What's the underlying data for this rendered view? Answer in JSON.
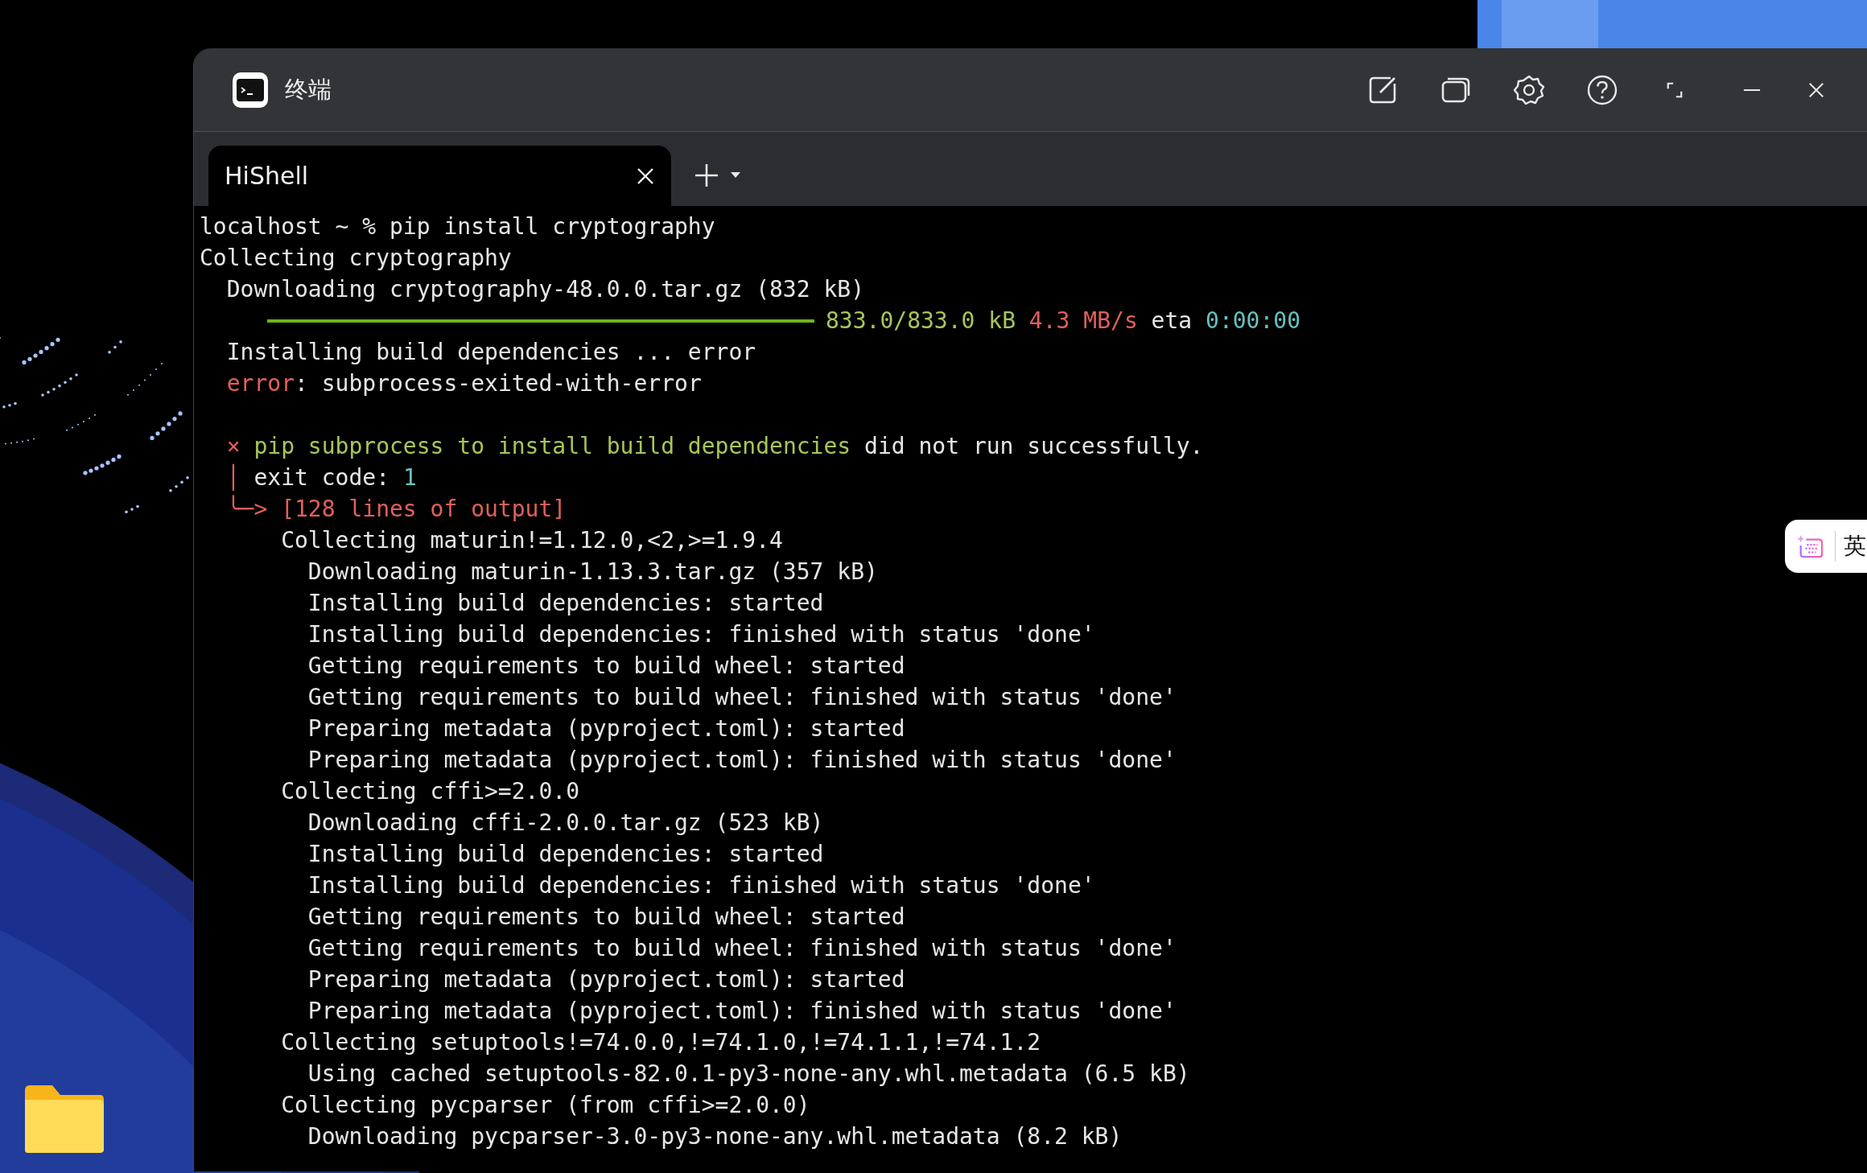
{
  "window": {
    "title": "终端"
  },
  "tabs": [
    {
      "label": "HiShell",
      "selected": true
    }
  ],
  "terminal": {
    "lines": [
      {
        "kind": "text",
        "segments": [
          {
            "text": "localhost ~ % pip install cryptography",
            "color": "#e6e6e6"
          }
        ]
      },
      {
        "kind": "text",
        "segments": [
          {
            "text": "Collecting cryptography",
            "color": "#e6e6e6"
          }
        ]
      },
      {
        "kind": "text",
        "segments": [
          {
            "text": "  Downloading cryptography-48.0.0.tar.gz (832 kB)",
            "color": "#e6e6e6"
          }
        ]
      },
      {
        "kind": "progress",
        "level": 1,
        "segments": [
          {
            "text": "833.0/833.0 kB",
            "color": "#a7c65a"
          },
          {
            "text": " 4.3 MB/s",
            "color": "#e0605a"
          },
          {
            "text": " eta ",
            "color": "#e6e6e6"
          },
          {
            "text": "0:00:00",
            "color": "#66c2c0"
          }
        ]
      },
      {
        "kind": "text",
        "segments": [
          {
            "text": "  Installing build dependencies ... error",
            "color": "#e6e6e6"
          }
        ]
      },
      {
        "kind": "text",
        "segments": [
          {
            "text": "  error",
            "color": "#e0605a"
          },
          {
            "text": ": subprocess-exited-with-error",
            "color": "#e6e6e6"
          }
        ]
      },
      {
        "kind": "blank"
      },
      {
        "kind": "text",
        "segments": [
          {
            "text": "  ×",
            "color": "#e0605a"
          },
          {
            "text": " pip subprocess to install build dependencies",
            "color": "#a7c65a"
          },
          {
            "text": " did not run successfully.",
            "color": "#e6e6e6"
          }
        ]
      },
      {
        "kind": "text",
        "segments": [
          {
            "text": "  │",
            "color": "#e0605a"
          },
          {
            "text": " exit code: ",
            "color": "#e6e6e6"
          },
          {
            "text": "1",
            "color": "#66c2c0"
          }
        ]
      },
      {
        "kind": "text",
        "segments": [
          {
            "text": "  ╰─> [128 lines of output]",
            "color": "#e0605a"
          }
        ]
      },
      {
        "kind": "text",
        "segments": [
          {
            "text": "      Collecting maturin!=1.12.0,<2,>=1.9.4",
            "color": "#e6e6e6"
          }
        ]
      },
      {
        "kind": "text",
        "segments": [
          {
            "text": "        Downloading maturin-1.13.3.tar.gz (357 kB)",
            "color": "#e6e6e6"
          }
        ]
      },
      {
        "kind": "text",
        "segments": [
          {
            "text": "        Installing build dependencies: started",
            "color": "#e6e6e6"
          }
        ]
      },
      {
        "kind": "text",
        "segments": [
          {
            "text": "        Installing build dependencies: finished with status 'done'",
            "color": "#e6e6e6"
          }
        ]
      },
      {
        "kind": "text",
        "segments": [
          {
            "text": "        Getting requirements to build wheel: started",
            "color": "#e6e6e6"
          }
        ]
      },
      {
        "kind": "text",
        "segments": [
          {
            "text": "        Getting requirements to build wheel: finished with status 'done'",
            "color": "#e6e6e6"
          }
        ]
      },
      {
        "kind": "text",
        "segments": [
          {
            "text": "        Preparing metadata (pyproject.toml): started",
            "color": "#e6e6e6"
          }
        ]
      },
      {
        "kind": "text",
        "segments": [
          {
            "text": "        Preparing metadata (pyproject.toml): finished with status 'done'",
            "color": "#e6e6e6"
          }
        ]
      },
      {
        "kind": "text",
        "segments": [
          {
            "text": "      Collecting cffi>=2.0.0",
            "color": "#e6e6e6"
          }
        ]
      },
      {
        "kind": "text",
        "segments": [
          {
            "text": "        Downloading cffi-2.0.0.tar.gz (523 kB)",
            "color": "#e6e6e6"
          }
        ]
      },
      {
        "kind": "text",
        "segments": [
          {
            "text": "        Installing build dependencies: started",
            "color": "#e6e6e6"
          }
        ]
      },
      {
        "kind": "text",
        "segments": [
          {
            "text": "        Installing build dependencies: finished with status 'done'",
            "color": "#e6e6e6"
          }
        ]
      },
      {
        "kind": "text",
        "segments": [
          {
            "text": "        Getting requirements to build wheel: started",
            "color": "#e6e6e6"
          }
        ]
      },
      {
        "kind": "text",
        "segments": [
          {
            "text": "        Getting requirements to build wheel: finished with status 'done'",
            "color": "#e6e6e6"
          }
        ]
      },
      {
        "kind": "text",
        "segments": [
          {
            "text": "        Preparing metadata (pyproject.toml): started",
            "color": "#e6e6e6"
          }
        ]
      },
      {
        "kind": "text",
        "segments": [
          {
            "text": "        Preparing metadata (pyproject.toml): finished with status 'done'",
            "color": "#e6e6e6"
          }
        ]
      },
      {
        "kind": "text",
        "segments": [
          {
            "text": "      Collecting setuptools!=74.0.0,!=74.1.0,!=74.1.1,!=74.1.2",
            "color": "#e6e6e6"
          }
        ]
      },
      {
        "kind": "text",
        "segments": [
          {
            "text": "        Using cached setuptools-82.0.1-py3-none-any.whl.metadata (6.5 kB)",
            "color": "#e6e6e6"
          }
        ]
      },
      {
        "kind": "text",
        "segments": [
          {
            "text": "      Collecting pycparser (from cffi>=2.0.0)",
            "color": "#e6e6e6"
          }
        ]
      },
      {
        "kind": "text",
        "segments": [
          {
            "text": "        Downloading pycparser-3.0-py3-none-any.whl.metadata (8.2 kB)",
            "color": "#e6e6e6"
          }
        ]
      }
    ]
  },
  "ime_toolbar": {
    "label": "英"
  }
}
